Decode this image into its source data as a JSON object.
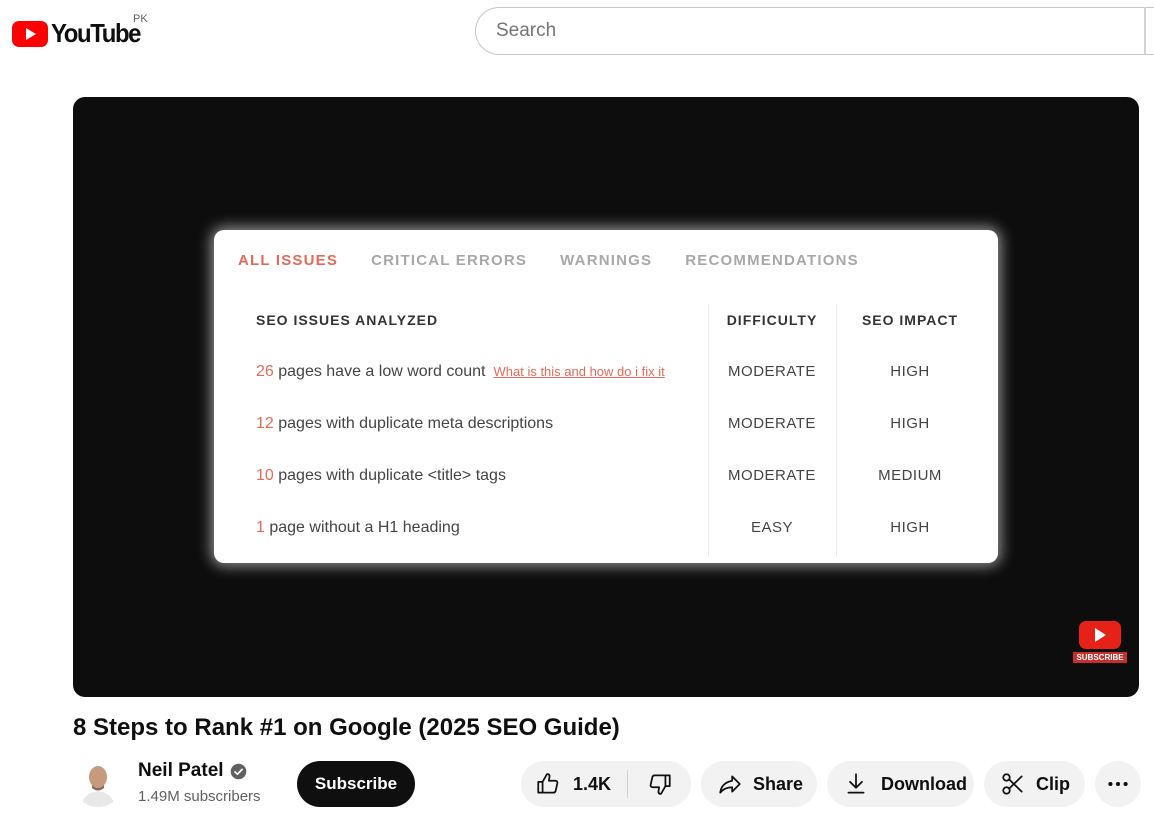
{
  "header": {
    "logo_text": "YouTube",
    "country_code": "PK",
    "search_placeholder": "Search"
  },
  "video": {
    "seo_table": {
      "tabs": [
        {
          "label": "ALL ISSUES",
          "active": true
        },
        {
          "label": "CRITICAL ERRORS",
          "active": false
        },
        {
          "label": "WARNINGS",
          "active": false
        },
        {
          "label": "RECOMMENDATIONS",
          "active": false
        }
      ],
      "columns": [
        "SEO ISSUES ANALYZED",
        "DIFFICULTY",
        "SEO IMPACT"
      ],
      "rows": [
        {
          "count": "26",
          "text": " pages have a low word count",
          "help": "What is this and how do i fix it",
          "difficulty": "MODERATE",
          "impact": "HIGH"
        },
        {
          "count": "12",
          "text": " pages with duplicate meta descriptions",
          "help": "",
          "difficulty": "MODERATE",
          "impact": "HIGH"
        },
        {
          "count": "10",
          "text": " pages with  duplicate <title> tags",
          "help": "",
          "difficulty": "MODERATE",
          "impact": "MEDIUM"
        },
        {
          "count": "1",
          "text": " page without a H1 heading",
          "help": "",
          "difficulty": "EASY",
          "impact": "HIGH"
        }
      ],
      "accent_color": "#e56a59"
    },
    "subscribe_badge": "SUBSCRIBE"
  },
  "info": {
    "title": "8 Steps to Rank #1 on Google (2025 SEO Guide)",
    "channel_name": "Neil Patel",
    "subscribers": "1.49M subscribers",
    "subscribe_label": "Subscribe",
    "like_count": "1.4K",
    "share_label": "Share",
    "download_label": "Download",
    "clip_label": "Clip"
  },
  "icons": [
    "youtube-logo-icon",
    "verified-icon",
    "like-icon",
    "dislike-icon",
    "share-icon",
    "download-icon",
    "clip-icon",
    "more-icon"
  ],
  "colors": {
    "brand_red": "#ff0000",
    "subscribe_bg": "#0f0f0f",
    "pill_bg": "#f2f2f2"
  }
}
